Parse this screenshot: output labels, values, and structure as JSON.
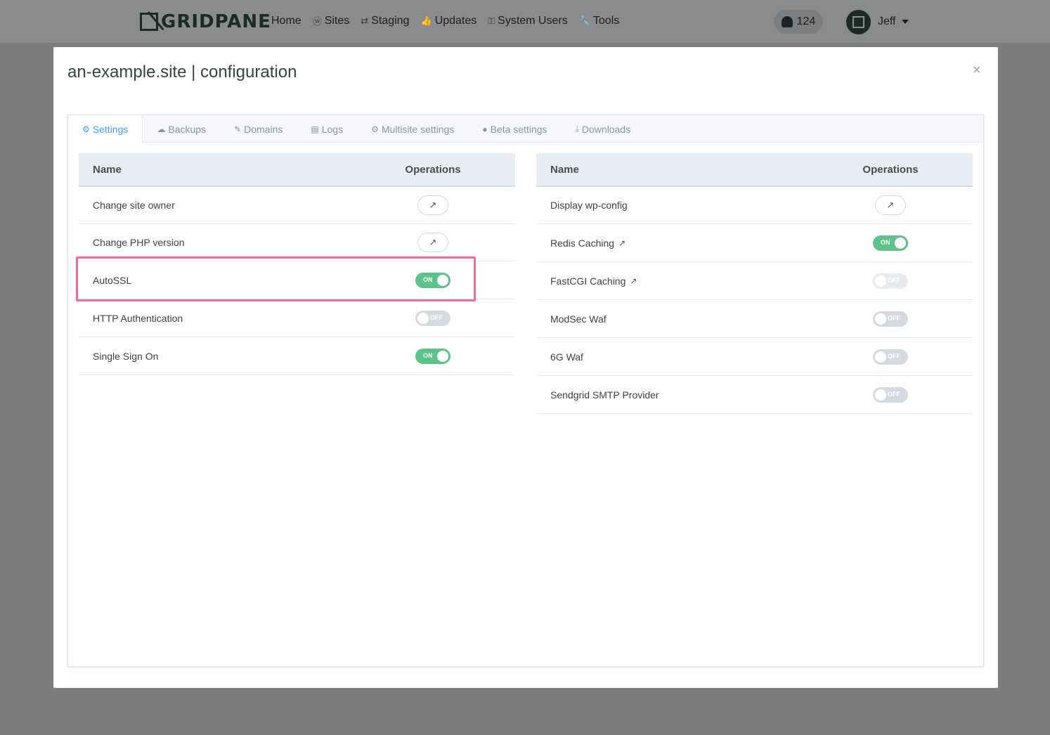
{
  "brand": {
    "name": "GRIDPANE"
  },
  "nav": {
    "items": [
      {
        "label": "Home",
        "icon": ""
      },
      {
        "label": "Sites",
        "icon": "ⓦ"
      },
      {
        "label": "Staging",
        "icon": "⇄"
      },
      {
        "label": "Updates",
        "icon": "👍"
      },
      {
        "label": "System Users",
        "icon": "⚿"
      },
      {
        "label": "Tools",
        "icon": "🔧"
      }
    ],
    "notifications": "124",
    "user": "Jeff"
  },
  "modal": {
    "title": "an-example.site | configuration",
    "close": "×"
  },
  "tabs": [
    {
      "label": "Settings",
      "icon": "⚙"
    },
    {
      "label": "Backups",
      "icon": "☁"
    },
    {
      "label": "Domains",
      "icon": "✎"
    },
    {
      "label": "Logs",
      "icon": "▤"
    },
    {
      "label": "Multisite settings",
      "icon": "⚙"
    },
    {
      "label": "Beta settings",
      "icon": "●"
    },
    {
      "label": "Downloads",
      "icon": "⤓"
    }
  ],
  "left_table": {
    "headers": {
      "name": "Name",
      "ops": "Operations"
    },
    "rows": [
      {
        "name": "Change site owner",
        "op": "button"
      },
      {
        "name": "Change PHP version",
        "op": "button"
      },
      {
        "name": "AutoSSL",
        "op": "toggle",
        "state": "ON"
      },
      {
        "name": "HTTP Authentication",
        "op": "toggle",
        "state": "OFF"
      },
      {
        "name": "Single Sign On",
        "op": "toggle",
        "state": "ON"
      }
    ]
  },
  "right_table": {
    "headers": {
      "name": "Name",
      "ops": "Operations"
    },
    "rows": [
      {
        "name": "Display wp-config",
        "op": "button"
      },
      {
        "name": "Redis Caching",
        "op": "toggle",
        "state": "ON",
        "link": true
      },
      {
        "name": "FastCGI Caching",
        "op": "toggle",
        "state": "OFF",
        "link": true
      },
      {
        "name": "ModSec Waf",
        "op": "toggle",
        "state": "OFF"
      },
      {
        "name": "6G Waf",
        "op": "toggle",
        "state": "OFF"
      },
      {
        "name": "Sendgrid SMTP Provider",
        "op": "toggle",
        "state": "OFF"
      }
    ]
  },
  "colors": {
    "accent": "#409eff",
    "toggle_on": "#5cc28a",
    "toggle_off": "#d5dae1",
    "highlight": "#ef6d97"
  }
}
